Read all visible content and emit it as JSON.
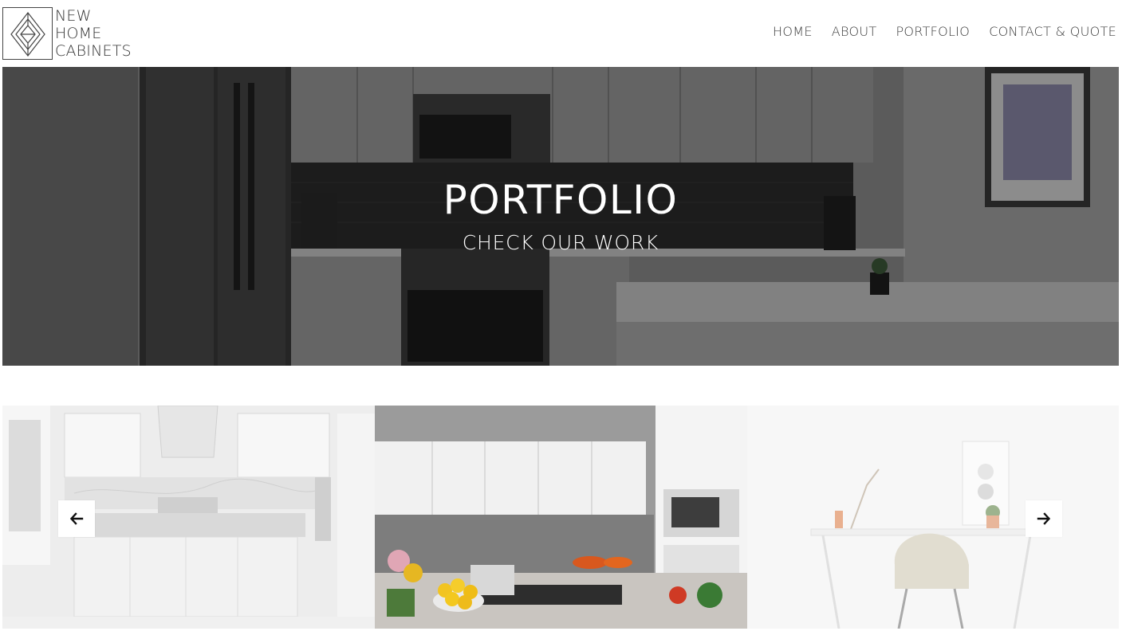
{
  "logo": {
    "line1": "NEW",
    "line2": "HOME",
    "line3": "CABINETS"
  },
  "nav": {
    "home": "HOME",
    "about": "ABOUT",
    "portfolio": "PORTFOLIO",
    "contact": "CONTACT & QUOTE"
  },
  "hero": {
    "title": "PORTFOLIO",
    "subtitle": "CHECK OUR WORK"
  },
  "gallery": {
    "slides": [
      {
        "subject": "white marble kitchen island"
      },
      {
        "subject": "white kitchen with lemons and cooktop"
      },
      {
        "subject": "white desk with chair"
      }
    ],
    "prev_icon": "arrow-left-icon",
    "next_icon": "arrow-right-icon"
  },
  "colors": {
    "text": "#3a3a3a",
    "hero_text": "#ffffff",
    "background": "#ffffff"
  }
}
